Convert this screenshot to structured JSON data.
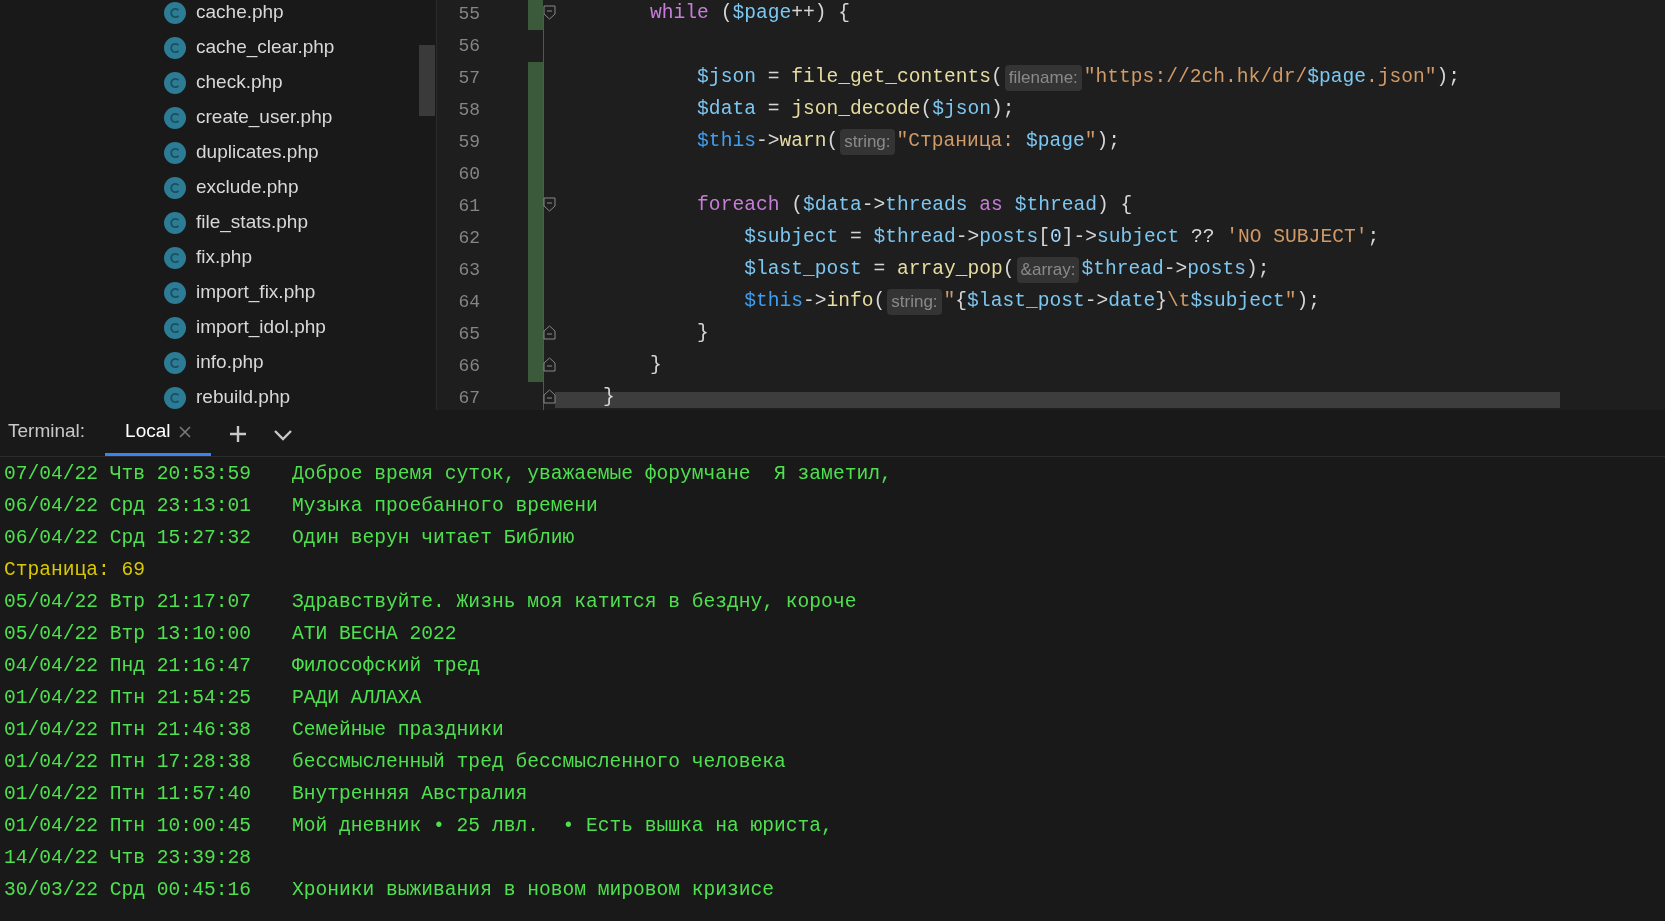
{
  "file_tree": {
    "items": [
      {
        "name": "cache.php"
      },
      {
        "name": "cache_clear.php"
      },
      {
        "name": "check.php"
      },
      {
        "name": "create_user.php"
      },
      {
        "name": "duplicates.php"
      },
      {
        "name": "exclude.php"
      },
      {
        "name": "file_stats.php"
      },
      {
        "name": "fix.php"
      },
      {
        "name": "import_fix.php"
      },
      {
        "name": "import_idol.php"
      },
      {
        "name": "info.php"
      },
      {
        "name": "rebuild.php"
      }
    ]
  },
  "editor": {
    "lines": [
      {
        "number": "55",
        "changed": true,
        "fold_start": true,
        "fold_end": false,
        "tokens": [
          {
            "kind": "kw",
            "text": "        while"
          },
          {
            "kind": "txt",
            "text": " ("
          },
          {
            "kind": "var",
            "text": "$page"
          },
          {
            "kind": "txt",
            "text": "++) {"
          }
        ]
      },
      {
        "number": "56",
        "changed": false,
        "fold_start": false,
        "fold_end": false
      },
      {
        "number": "57",
        "changed": true,
        "fold_start": false,
        "fold_end": false,
        "tokens": [
          {
            "kind": "var",
            "text": "            $json"
          },
          {
            "kind": "txt",
            "text": " = "
          },
          {
            "kind": "fn",
            "text": "file_get_contents"
          },
          {
            "kind": "txt",
            "text": "("
          },
          {
            "kind": "hint",
            "text": "filename:"
          },
          {
            "kind": "str",
            "text": "\"https://2ch.hk/dr/"
          },
          {
            "kind": "var",
            "text": "$page"
          },
          {
            "kind": "str",
            "text": ".json\""
          },
          {
            "kind": "txt",
            "text": ");"
          }
        ]
      },
      {
        "number": "58",
        "changed": true,
        "fold_start": false,
        "fold_end": false,
        "tokens": [
          {
            "kind": "var",
            "text": "            $data"
          },
          {
            "kind": "txt",
            "text": " = "
          },
          {
            "kind": "fn",
            "text": "json_decode"
          },
          {
            "kind": "txt",
            "text": "("
          },
          {
            "kind": "var",
            "text": "$json"
          },
          {
            "kind": "txt",
            "text": ");"
          }
        ]
      },
      {
        "number": "59",
        "changed": true,
        "fold_start": false,
        "fold_end": false,
        "tokens": [
          {
            "kind": "this",
            "text": "            $this"
          },
          {
            "kind": "txt",
            "text": "->"
          },
          {
            "kind": "fn",
            "text": "warn"
          },
          {
            "kind": "txt",
            "text": "("
          },
          {
            "kind": "hint",
            "text": "string:"
          },
          {
            "kind": "str",
            "text": "\"Страница: "
          },
          {
            "kind": "var",
            "text": "$page"
          },
          {
            "kind": "str",
            "text": "\""
          },
          {
            "kind": "txt",
            "text": ");"
          }
        ]
      },
      {
        "number": "60",
        "changed": true,
        "fold_start": false,
        "fold_end": false
      },
      {
        "number": "61",
        "changed": true,
        "fold_start": true,
        "fold_end": false,
        "tokens": [
          {
            "kind": "kw",
            "text": "            foreach"
          },
          {
            "kind": "txt",
            "text": " ("
          },
          {
            "kind": "var",
            "text": "$data"
          },
          {
            "kind": "txt",
            "text": "->"
          },
          {
            "kind": "var",
            "text": "threads"
          },
          {
            "kind": "kw",
            "text": " as "
          },
          {
            "kind": "var",
            "text": "$thread"
          },
          {
            "kind": "txt",
            "text": ") {"
          }
        ]
      },
      {
        "number": "62",
        "changed": true,
        "fold_start": false,
        "fold_end": false,
        "tokens": [
          {
            "kind": "var",
            "text": "                $subject"
          },
          {
            "kind": "txt",
            "text": " = "
          },
          {
            "kind": "var",
            "text": "$thread"
          },
          {
            "kind": "txt",
            "text": "->"
          },
          {
            "kind": "var",
            "text": "posts"
          },
          {
            "kind": "txt",
            "text": "["
          },
          {
            "kind": "num",
            "text": "0"
          },
          {
            "kind": "txt",
            "text": "]->"
          },
          {
            "kind": "var",
            "text": "subject"
          },
          {
            "kind": "txt",
            "text": " ?? "
          },
          {
            "kind": "str",
            "text": "'NO SUBJECT'"
          },
          {
            "kind": "txt",
            "text": ";"
          }
        ]
      },
      {
        "number": "63",
        "changed": true,
        "fold_start": false,
        "fold_end": false,
        "tokens": [
          {
            "kind": "var",
            "text": "                $last_post"
          },
          {
            "kind": "txt",
            "text": " = "
          },
          {
            "kind": "fn",
            "text": "array_pop"
          },
          {
            "kind": "txt",
            "text": "("
          },
          {
            "kind": "hint",
            "text": "&array:"
          },
          {
            "kind": "var",
            "text": "$thread"
          },
          {
            "kind": "txt",
            "text": "->"
          },
          {
            "kind": "var",
            "text": "posts"
          },
          {
            "kind": "txt",
            "text": ");"
          }
        ]
      },
      {
        "number": "64",
        "changed": true,
        "fold_start": false,
        "fold_end": false,
        "tokens": [
          {
            "kind": "this",
            "text": "                $this"
          },
          {
            "kind": "txt",
            "text": "->"
          },
          {
            "kind": "fn",
            "text": "info"
          },
          {
            "kind": "txt",
            "text": "("
          },
          {
            "kind": "hint",
            "text": "string:"
          },
          {
            "kind": "str",
            "text": "\""
          },
          {
            "kind": "txt",
            "text": "{"
          },
          {
            "kind": "var",
            "text": "$last_post"
          },
          {
            "kind": "txt",
            "text": "->"
          },
          {
            "kind": "var",
            "text": "date"
          },
          {
            "kind": "txt",
            "text": "}"
          },
          {
            "kind": "str",
            "text": "\\t"
          },
          {
            "kind": "var",
            "text": "$subject"
          },
          {
            "kind": "str",
            "text": "\""
          },
          {
            "kind": "txt",
            "text": ");"
          }
        ]
      },
      {
        "number": "65",
        "changed": true,
        "fold_start": false,
        "fold_end": true,
        "tokens": [
          {
            "kind": "txt",
            "text": "            }"
          }
        ]
      },
      {
        "number": "66",
        "changed": true,
        "fold_start": false,
        "fold_end": true,
        "tokens": [
          {
            "kind": "txt",
            "text": "        }"
          }
        ]
      },
      {
        "number": "67",
        "changed": false,
        "fold_start": false,
        "fold_end": true,
        "tokens": [
          {
            "kind": "txt",
            "text": "    }"
          }
        ]
      }
    ]
  },
  "terminal": {
    "label": "Terminal:",
    "tabs": [
      {
        "label": "Local",
        "selected": true
      }
    ],
    "lines": [
      {
        "warning": false,
        "time": "07/04/22 Чтв 20:53:59",
        "message": "Доброе время суток, уважаемые форумчане  Я заметил,"
      },
      {
        "warning": false,
        "time": "06/04/22 Срд 23:13:01",
        "message": "Музыка проебанного времени"
      },
      {
        "warning": false,
        "time": "06/04/22 Срд 15:27:32",
        "message": "Один верун читает Библию"
      },
      {
        "warning": true,
        "message": "Страница: 69"
      },
      {
        "warning": false,
        "time": "05/04/22 Втр 21:17:07",
        "message": "Здравствуйте. Жизнь моя катится в бездну, короче"
      },
      {
        "warning": false,
        "time": "05/04/22 Втр 13:10:00",
        "message": "АТИ ВЕСНА 2022"
      },
      {
        "warning": false,
        "time": "04/04/22 Пнд 21:16:47",
        "message": "Философский тред"
      },
      {
        "warning": false,
        "time": "01/04/22 Птн 21:54:25",
        "message": "РАДИ АЛЛАХА"
      },
      {
        "warning": false,
        "time": "01/04/22 Птн 21:46:38",
        "message": "Семейные праздники"
      },
      {
        "warning": false,
        "time": "01/04/22 Птн 17:28:38",
        "message": "бессмысленный тред бессмысленного человека"
      },
      {
        "warning": false,
        "time": "01/04/22 Птн 11:57:40",
        "message": "Внутренняя Австралия"
      },
      {
        "warning": false,
        "time": "01/04/22 Птн 10:00:45",
        "message": "Мой дневник • 25 лвл.  • Есть вышка на юриста,"
      },
      {
        "warning": false,
        "time": "14/04/22 Чтв 23:39:28"
      },
      {
        "warning": false,
        "time": "30/03/22 Срд 00:45:16",
        "message": "Хроники выживания в новом мировом кризисе"
      }
    ]
  }
}
